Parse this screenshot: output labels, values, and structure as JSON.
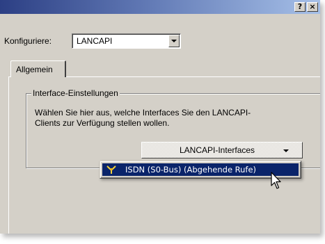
{
  "window": {
    "help_button": "?",
    "close_button": "×"
  },
  "config": {
    "label": "Konfiguriere:",
    "selected_value": "LANCAPI"
  },
  "tabs": [
    {
      "label": "Allgemein",
      "active": true
    }
  ],
  "interface_group": {
    "title": "Interface-Einstellungen",
    "description": "Wählen Sie hier aus, welche Interfaces Sie den LANCAPI-Clients zur Verfügung stellen wollen.",
    "dropdown_label": "LANCAPI-Interfaces"
  },
  "popup_menu": {
    "items": [
      {
        "label": "ISDN (S0-Bus) (Abgehende Rufe)",
        "icon": "isdn-plug-icon",
        "highlighted": true
      }
    ]
  },
  "colors": {
    "titlebar_start": "#2c3f84",
    "titlebar_end": "#a6c0e8",
    "dialog_bg": "#d4d0c8",
    "menu_highlight": "#0a246a"
  }
}
